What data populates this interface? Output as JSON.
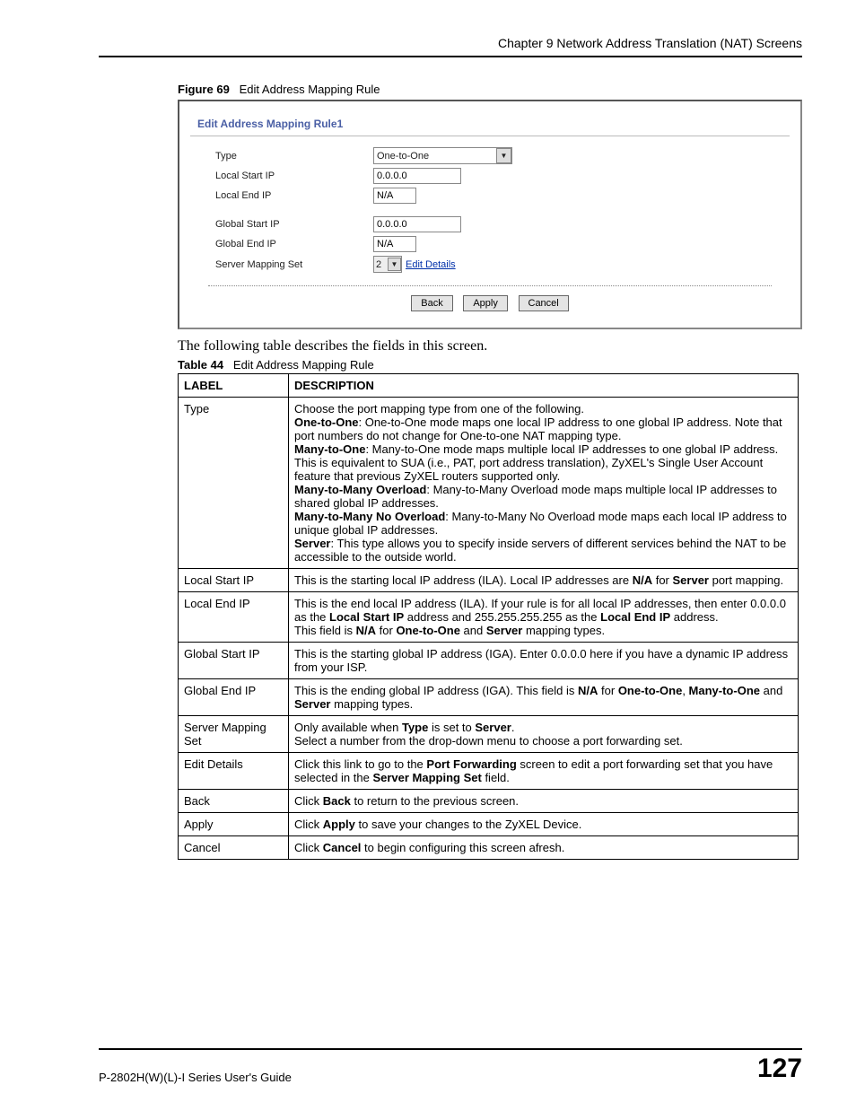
{
  "header": {
    "chapter": "Chapter 9 Network Address Translation (NAT) Screens"
  },
  "figure": {
    "number": "Figure 69",
    "title": "Edit Address Mapping Rule"
  },
  "panel": {
    "title": "Edit Address Mapping Rule1",
    "rows": {
      "type_label": "Type",
      "type_value": "One-to-One",
      "local_start_label": "Local Start IP",
      "local_start_value": "0.0.0.0",
      "local_end_label": "Local End IP",
      "local_end_value": "N/A",
      "global_start_label": "Global Start IP",
      "global_start_value": "0.0.0.0",
      "global_end_label": "Global End IP",
      "global_end_value": "N/A",
      "server_set_label": "Server Mapping Set",
      "server_set_value": "2",
      "edit_details": "Edit Details"
    },
    "buttons": {
      "back": "Back",
      "apply": "Apply",
      "cancel": "Cancel"
    }
  },
  "lead_text": "The following table describes the fields in this screen.",
  "table_caption": {
    "number": "Table 44",
    "title": "Edit Address Mapping Rule"
  },
  "table": {
    "head_label": "LABEL",
    "head_desc": "DESCRIPTION",
    "rows": [
      {
        "label": "Type",
        "desc": "Choose the port mapping type from one of the following.<br><b>One-to-One</b>: One-to-One mode maps one local IP address to one global IP address. Note that port numbers do not change for One-to-one NAT mapping type.<br><b>Many-to-One</b>: Many-to-One mode maps multiple local IP addresses to one global IP address. This is equivalent to SUA (i.e., PAT, port address translation), ZyXEL's Single User Account feature that previous ZyXEL routers supported only.<br><b>Many-to-Many Overload</b>: Many-to-Many Overload mode maps multiple local IP addresses to shared global IP addresses.<br><b>Many-to-Many No Overload</b>: Many-to-Many No Overload mode maps each local IP address to unique global IP addresses.<br><b>Server</b>: This type allows you to specify inside servers of different services behind the NAT to be accessible to the outside world."
      },
      {
        "label": "Local Start IP",
        "desc": "This is the starting local IP address (ILA). Local IP addresses are <b>N/A</b> for <b>Server</b> port mapping."
      },
      {
        "label": "Local End IP",
        "desc": "This is the end local IP address (ILA). If your rule is for all local IP addresses, then enter 0.0.0.0 as the <b>Local Start IP</b> address and 255.255.255.255 as the <b>Local End IP</b> address.<br>This field is <b>N/A</b> for <b>One-to-One</b> and <b>Server</b> mapping types."
      },
      {
        "label": "Global Start IP",
        "desc": "This is the starting global IP address (IGA). Enter 0.0.0.0 here if you have a dynamic IP address from your ISP."
      },
      {
        "label": "Global End IP",
        "desc": "This is the ending global IP address (IGA). This field is <b>N/A</b> for <b>One-to-One</b>, <b>Many-to-One</b> and <b>Server</b> mapping types."
      },
      {
        "label": "Server Mapping Set",
        "desc": "Only available when <b>Type</b> is set to <b>Server</b>.<br>Select a number from the drop-down menu to choose a port forwarding set."
      },
      {
        "label": "Edit Details",
        "desc": "Click this link to go to the <b>Port Forwarding</b> screen to edit a port forwarding set that you have selected in the <b>Server Mapping Set</b> field."
      },
      {
        "label": "Back",
        "desc": "Click <b>Back</b> to return to the previous screen."
      },
      {
        "label": "Apply",
        "desc": "Click <b>Apply</b> to save your changes to the ZyXEL Device."
      },
      {
        "label": "Cancel",
        "desc": "Click <b>Cancel</b> to begin configuring this screen afresh."
      }
    ]
  },
  "footer": {
    "left": "P-2802H(W)(L)-I Series User's Guide",
    "right": "127"
  }
}
